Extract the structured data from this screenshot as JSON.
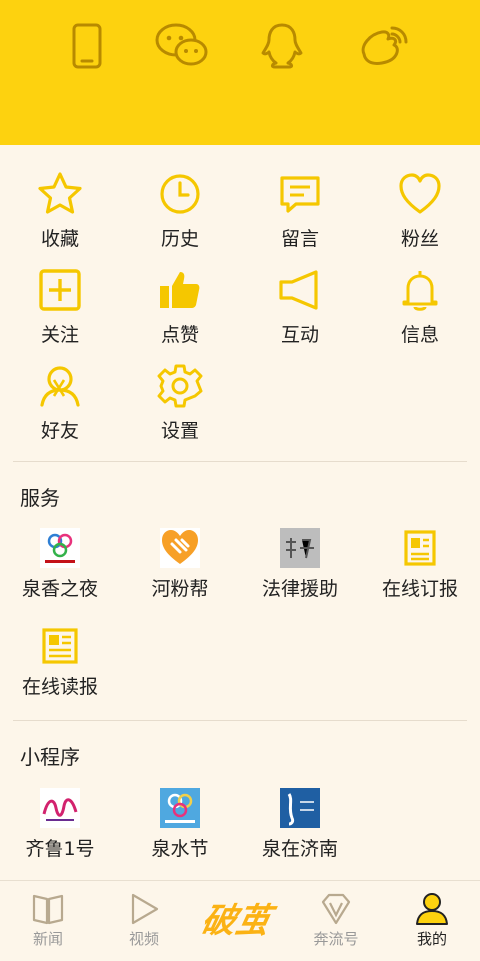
{
  "colors": {
    "accent": "#fdd20f",
    "icon": "#f5c700",
    "icon_dark": "#b88a00",
    "background": "#fdf6ea"
  },
  "header": {
    "login_icons": [
      "phone-icon",
      "wechat-icon",
      "qq-icon",
      "weibo-icon"
    ]
  },
  "grid": [
    {
      "label": "收藏",
      "icon": "star-icon"
    },
    {
      "label": "历史",
      "icon": "clock-icon"
    },
    {
      "label": "留言",
      "icon": "message-icon"
    },
    {
      "label": "粉丝",
      "icon": "heart-icon"
    },
    {
      "label": "关注",
      "icon": "plus-square-icon"
    },
    {
      "label": "点赞",
      "icon": "thumbs-up-icon"
    },
    {
      "label": "互动",
      "icon": "megaphone-icon"
    },
    {
      "label": "信息",
      "icon": "bell-icon"
    },
    {
      "label": "好友",
      "icon": "friend-icon"
    },
    {
      "label": "设置",
      "icon": "gear-icon"
    }
  ],
  "services": {
    "title": "服务",
    "items": [
      {
        "label": "泉香之夜",
        "icon": "quanxiang-logo"
      },
      {
        "label": "河粉帮",
        "icon": "hefenbang-logo"
      },
      {
        "label": "法律援助",
        "icon": "legal-aid-logo"
      },
      {
        "label": "在线订报",
        "icon": "newspaper-order-icon"
      },
      {
        "label": "在线读报",
        "icon": "newspaper-read-icon"
      }
    ]
  },
  "mini_programs": {
    "title": "小程序",
    "items": [
      {
        "label": "齐鲁1号",
        "icon": "qilu-logo"
      },
      {
        "label": "泉水节",
        "icon": "spring-festival-logo"
      },
      {
        "label": "泉在济南",
        "icon": "quan-jinan-logo"
      }
    ]
  },
  "tabbar": {
    "tabs": [
      {
        "label": "新闻",
        "icon": "book-icon"
      },
      {
        "label": "视频",
        "icon": "play-icon"
      },
      {
        "label": "奔流号",
        "icon": "v-diamond-icon"
      },
      {
        "label": "我的",
        "icon": "user-icon"
      }
    ],
    "brand": "破茧"
  }
}
